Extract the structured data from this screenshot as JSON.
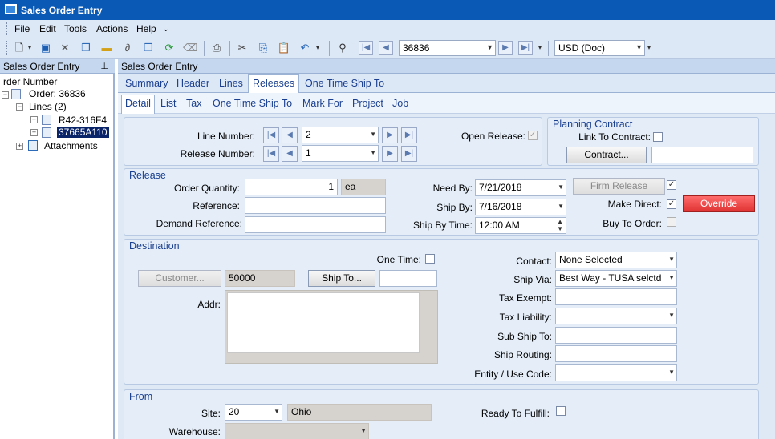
{
  "window": {
    "title": "Sales Order Entry"
  },
  "menu": [
    "File",
    "Edit",
    "Tools",
    "Actions",
    "Help"
  ],
  "toolbar": {
    "order_number": "36836",
    "currency": "USD (Doc)"
  },
  "left_panel": {
    "header": "Sales Order Entry",
    "tree": {
      "root": "rder Number",
      "order": "Order: 36836",
      "lines": "Lines (2)",
      "line1": "R42-316F4",
      "line2": "37665A110",
      "attachments": "Attachments"
    }
  },
  "right_header": "Sales Order Entry",
  "tabs": [
    "Summary",
    "Header",
    "Lines",
    "Releases",
    "One Time Ship To"
  ],
  "subtabs": [
    "Detail",
    "List",
    "Tax",
    "One Time Ship To",
    "Mark For",
    "Project",
    "Job"
  ],
  "line_section": {
    "line_number_label": "Line Number:",
    "line_number": "2",
    "release_number_label": "Release Number:",
    "release_number": "1",
    "open_release_label": "Open Release:",
    "open_release_checked": true
  },
  "planning_contract": {
    "title": "Planning Contract",
    "link_label": "Link To Contract:",
    "contract_button": "Contract...",
    "contract_value": ""
  },
  "release": {
    "title": "Release",
    "order_qty_label": "Order Quantity:",
    "order_qty": "1",
    "uom": "ea",
    "reference_label": "Reference:",
    "reference": "",
    "demand_ref_label": "Demand Reference:",
    "demand_ref": "",
    "need_by_label": "Need By:",
    "need_by": "7/21/2018",
    "ship_by_label": "Ship By:",
    "ship_by": "7/16/2018",
    "ship_by_time_label": "Ship By Time:",
    "ship_by_time": "12:00 AM",
    "firm_release_button": "Firm Release",
    "firm_release_checked": true,
    "make_direct_label": "Make Direct:",
    "make_direct_checked": true,
    "override_button": "Override",
    "buy_to_order_label": "Buy To Order:",
    "colors": {
      "override": "#e03333"
    }
  },
  "destination": {
    "title": "Destination",
    "one_time_label": "One Time:",
    "customer_button": "Customer...",
    "customer_id": "50000",
    "ship_to_button": "Ship To...",
    "ship_to_value": "",
    "addr_label": "Addr:",
    "contact_label": "Contact:",
    "contact": "None Selected",
    "ship_via_label": "Ship Via:",
    "ship_via": "Best Way - TUSA selctd",
    "tax_exempt_label": "Tax Exempt:",
    "tax_exempt": "",
    "tax_liability_label": "Tax Liability:",
    "tax_liability": "",
    "sub_ship_to_label": "Sub Ship To:",
    "sub_ship_to": "",
    "ship_routing_label": "Ship Routing:",
    "ship_routing": "",
    "entity_label": "Entity / Use Code:",
    "entity": ""
  },
  "from": {
    "title": "From",
    "site_label": "Site:",
    "site": "20",
    "site_name": "Ohio",
    "ready_label": "Ready To Fulfill:",
    "warehouse_label": "Warehouse:",
    "warehouse": ""
  }
}
